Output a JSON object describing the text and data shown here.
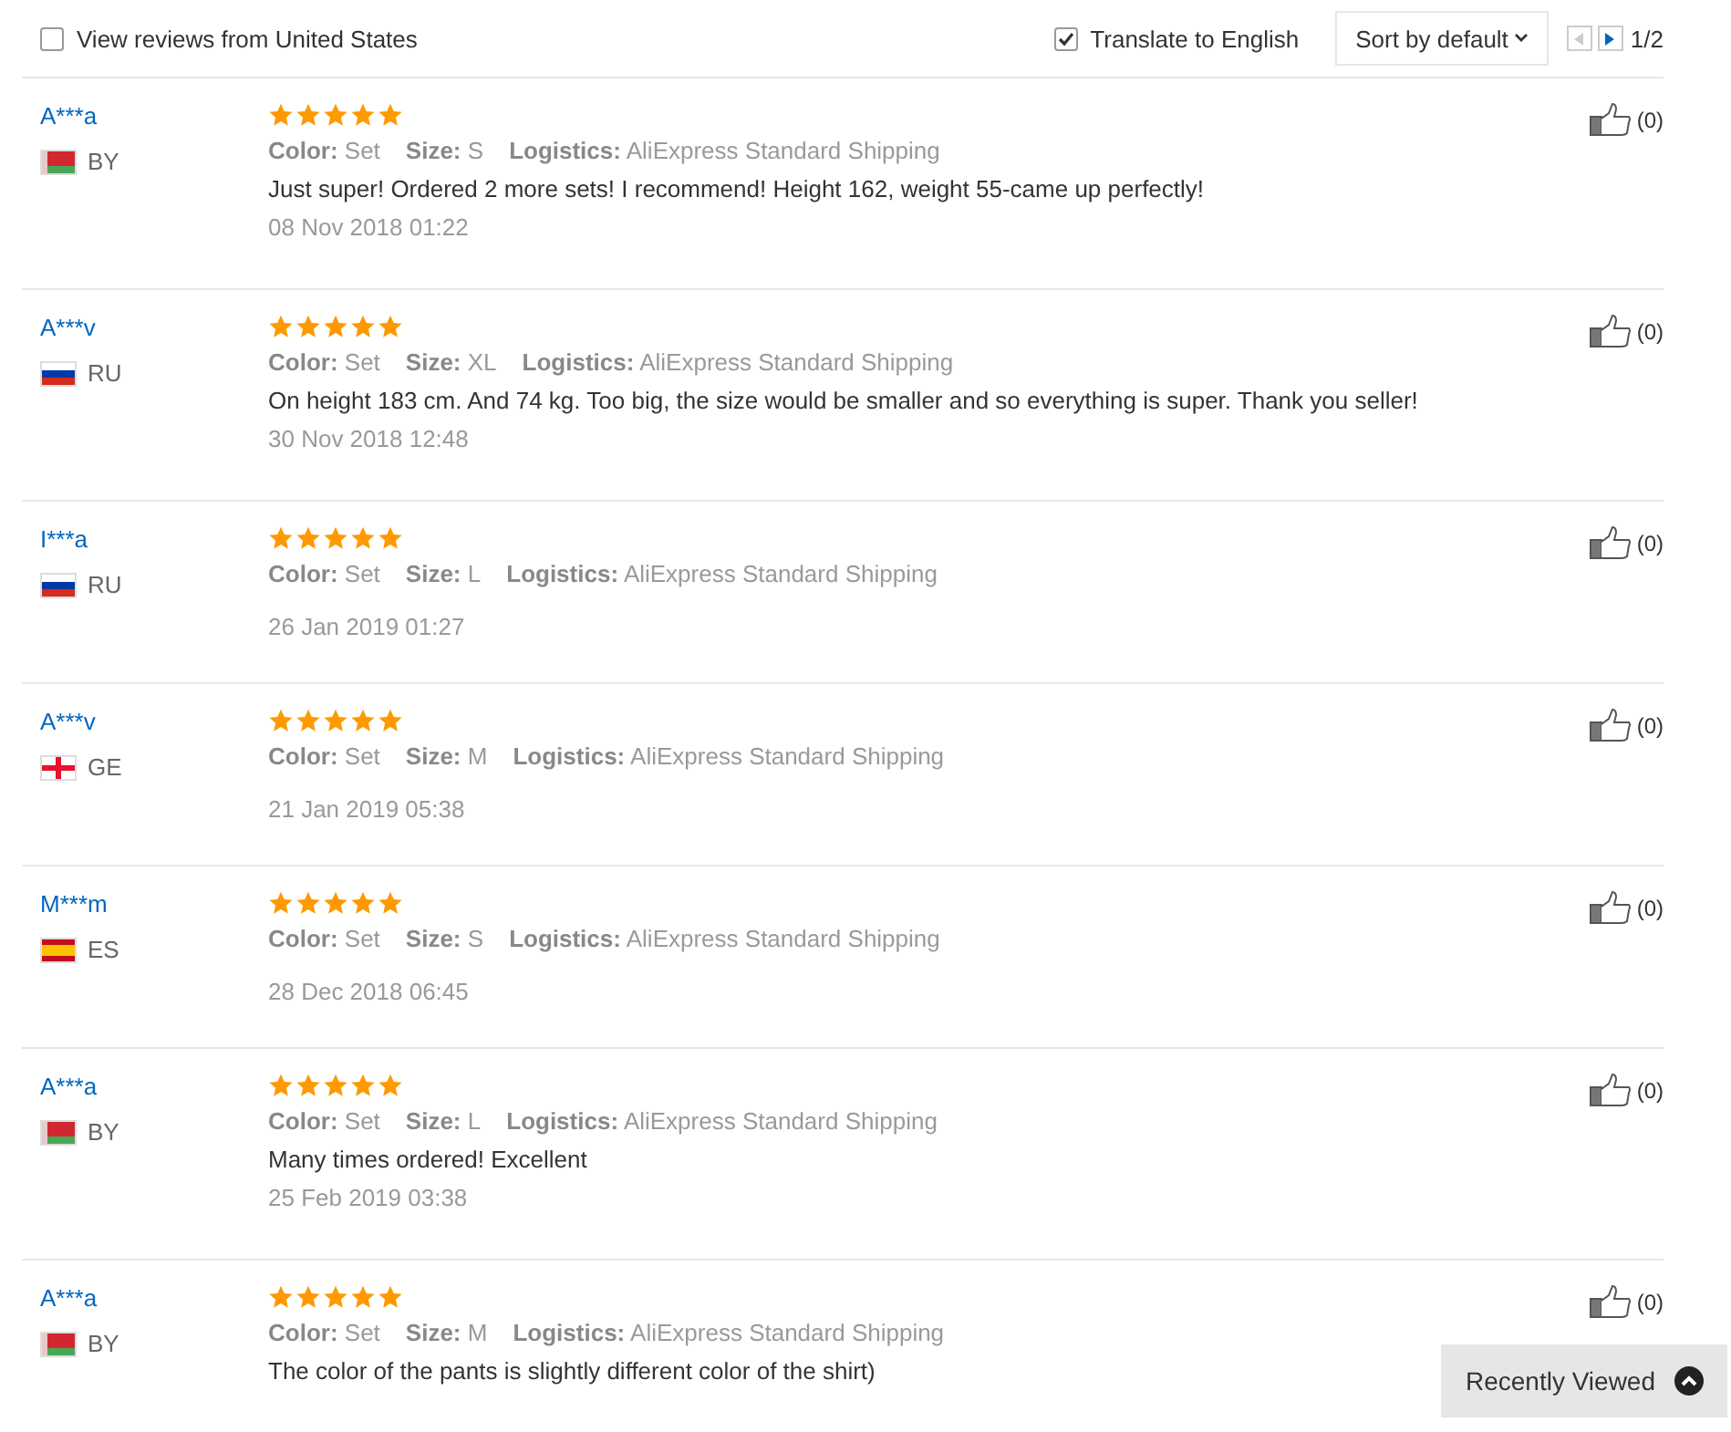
{
  "toolbar": {
    "filter": {
      "label": "View reviews from United States",
      "checked": false
    },
    "translate": {
      "label": "Translate to English",
      "checked": true
    },
    "sort": {
      "label": "Sort by default"
    },
    "pager": {
      "prev_disabled": true,
      "next_disabled": false,
      "page": "1/2"
    }
  },
  "reviews": [
    {
      "name": "A***a",
      "country": "BY",
      "stars": 5,
      "color_label": "Color:",
      "color_value": "Set",
      "size_label": "Size:",
      "size": "S",
      "logistics_label": "Logistics:",
      "logistics": "AliExpress Standard Shipping",
      "text": "Just super! Ordered 2 more sets! I recommend! Height 162, weight 55-came up perfectly!",
      "date": "08 Nov 2018 01:22",
      "likes": "(0)"
    },
    {
      "name": "A***v",
      "country": "RU",
      "stars": 5,
      "color_label": "Color:",
      "color_value": "Set",
      "size_label": "Size:",
      "size": "XL",
      "logistics_label": "Logistics:",
      "logistics": "AliExpress Standard Shipping",
      "text": "On height 183 cm. And 74 kg. Too big, the size would be smaller and so everything is super. Thank you seller!",
      "date": "30 Nov 2018 12:48",
      "likes": "(0)"
    },
    {
      "name": "I***a",
      "country": "RU",
      "stars": 5,
      "color_label": "Color:",
      "color_value": "Set",
      "size_label": "Size:",
      "size": "L",
      "logistics_label": "Logistics:",
      "logistics": "AliExpress Standard Shipping",
      "date": "26 Jan 2019 01:27",
      "likes": "(0)"
    },
    {
      "name": "A***v",
      "country": "GE",
      "stars": 5,
      "color_label": "Color:",
      "color_value": "Set",
      "size_label": "Size:",
      "size": "M",
      "logistics_label": "Logistics:",
      "logistics": "AliExpress Standard Shipping",
      "date": "21 Jan 2019 05:38",
      "likes": "(0)"
    },
    {
      "name": "M***m",
      "country": "ES",
      "stars": 5,
      "color_label": "Color:",
      "color_value": "Set",
      "size_label": "Size:",
      "size": "S",
      "logistics_label": "Logistics:",
      "logistics": "AliExpress Standard Shipping",
      "date": "28 Dec 2018 06:45",
      "likes": "(0)"
    },
    {
      "name": "A***a",
      "country": "BY",
      "stars": 5,
      "color_label": "Color:",
      "color_value": "Set",
      "size_label": "Size:",
      "size": "L",
      "logistics_label": "Logistics:",
      "logistics": "AliExpress Standard Shipping",
      "text": "Many times ordered! Excellent",
      "date": "25 Feb 2019 03:38",
      "likes": "(0)"
    },
    {
      "name": "A***a",
      "country": "BY",
      "stars": 5,
      "color_label": "Color:",
      "color_value": "Set",
      "size_label": "Size:",
      "size": "M",
      "logistics_label": "Logistics:",
      "logistics": "AliExpress Standard Shipping",
      "text": "The color of the pants is slightly different color of the shirt)",
      "likes": "(0)"
    }
  ],
  "recently_viewed": {
    "label": "Recently Viewed"
  }
}
